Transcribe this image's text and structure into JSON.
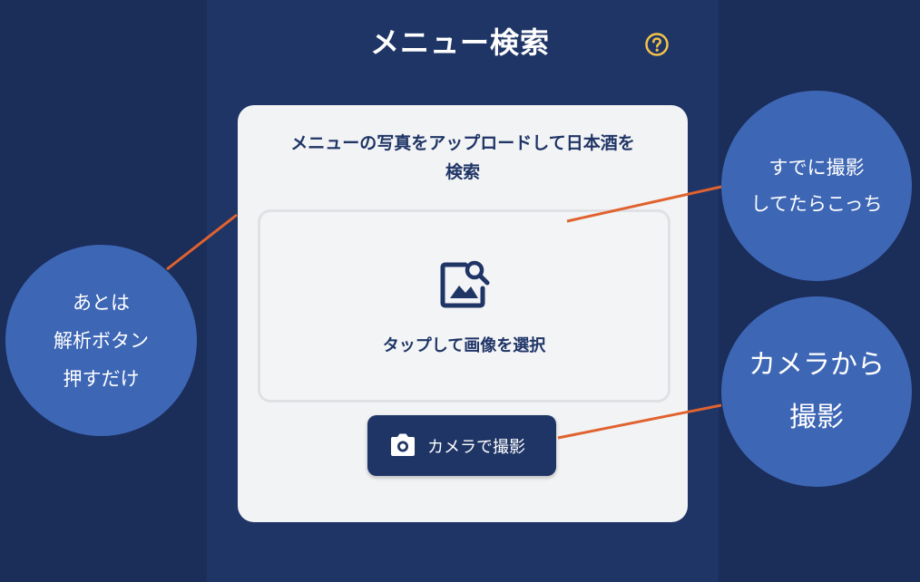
{
  "header": {
    "title": "メニュー検索",
    "help_icon": "help-circle-icon"
  },
  "card": {
    "title_line1": "メニューの写真をアップロードして日本酒を",
    "title_line2": "検索",
    "dropzone": {
      "icon": "image-search-icon",
      "label": "タップして画像を選択"
    },
    "camera_button": {
      "icon": "camera-icon",
      "label": "カメラで撮影"
    }
  },
  "annotations": {
    "left": [
      "あとは",
      "解析ボタン",
      "押すだけ"
    ],
    "top_right": [
      "すでに撮影",
      "してたらこっち"
    ],
    "bottom_right": [
      "カメラから",
      "撮影"
    ]
  },
  "colors": {
    "background": "#1b2d59",
    "primary": "#1f3566",
    "accent_help": "#f3c34a",
    "bubble": "#3d66b5",
    "connector": "#e0622f"
  }
}
